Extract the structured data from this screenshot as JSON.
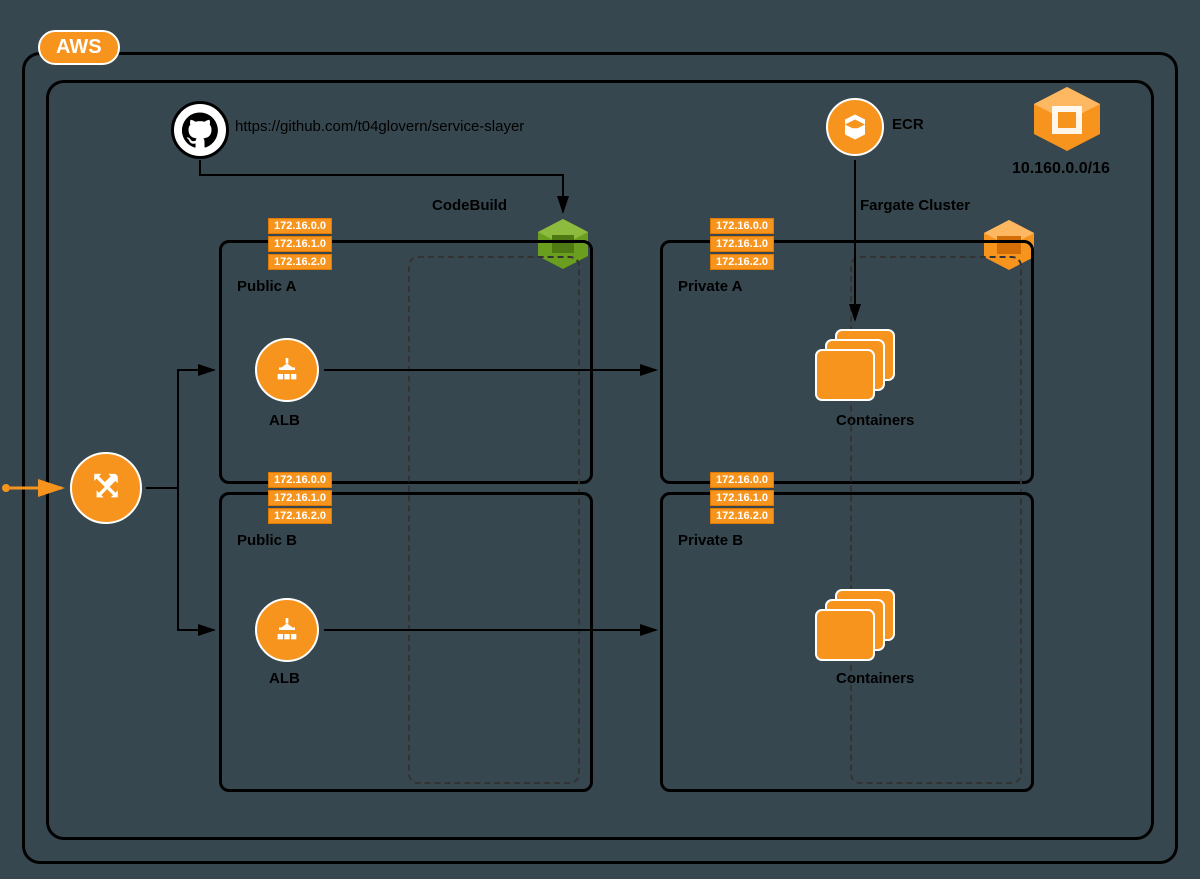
{
  "cloud": {
    "label": "AWS"
  },
  "github": {
    "url": "https://github.com/t04glovern/service-slayer"
  },
  "codebuild": {
    "label": "CodeBuild"
  },
  "ecr": {
    "label": "ECR"
  },
  "vpc": {
    "cidr": "10.160.0.0/16"
  },
  "fargate": {
    "label": "Fargate Cluster"
  },
  "subnets": {
    "publicA": {
      "name": "Public A",
      "alb": "ALB",
      "cidrs": [
        "172.16.0.0",
        "172.16.1.0",
        "172.16.2.0"
      ]
    },
    "publicB": {
      "name": "Public B",
      "alb": "ALB",
      "cidrs": [
        "172.16.0.0",
        "172.16.1.0",
        "172.16.2.0"
      ]
    },
    "privateA": {
      "name": "Private A",
      "containers": "Containers",
      "cidrs": [
        "172.16.0.0",
        "172.16.1.0",
        "172.16.2.0"
      ]
    },
    "privateB": {
      "name": "Private B",
      "containers": "Containers",
      "cidrs": [
        "172.16.0.0",
        "172.16.1.0",
        "172.16.2.0"
      ]
    }
  },
  "colors": {
    "orange": "#f7941e",
    "green": "#6a9e1f",
    "bg": "#37474f"
  }
}
